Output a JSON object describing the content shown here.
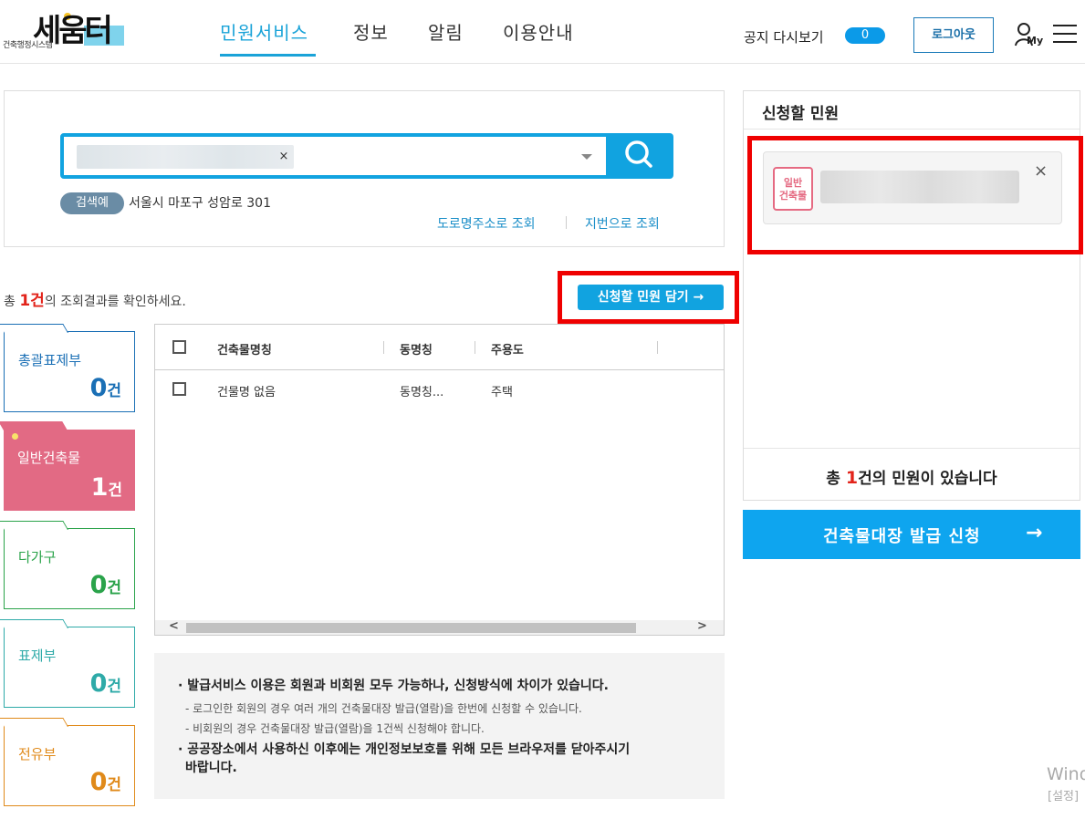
{
  "header": {
    "logo_text": "세움터",
    "logo_subtitle": "건축행정시스템",
    "nav": [
      "민원서비스",
      "정보",
      "알림",
      "이용안내"
    ],
    "notice_label": "공지 다시보기",
    "notice_count": "0",
    "logout_label": "로그아웃",
    "my_label": "My"
  },
  "search": {
    "chip_remove": "×",
    "example_tag": "검색예",
    "example_text": "서울시 마포구 성암로 301",
    "road_link": "도로명주소로 조회",
    "lot_link": "지번으로 조회"
  },
  "result": {
    "prefix": "총 ",
    "count": "1건",
    "suffix": "의 조회결과를 확인하세요.",
    "add_button": "신청할 민원 담기 →"
  },
  "categories": [
    {
      "label": "총괄표제부",
      "count": "0",
      "unit": "건",
      "color": "#1a6fb5"
    },
    {
      "label": "일반건축물",
      "count": "1",
      "unit": "건",
      "color": "#e26a84"
    },
    {
      "label": "다가구",
      "count": "0",
      "unit": "건",
      "color": "#2aa34a"
    },
    {
      "label": "표제부",
      "count": "0",
      "unit": "건",
      "color": "#2eaaa8"
    },
    {
      "label": "전유부",
      "count": "0",
      "unit": "건",
      "color": "#e08a1a"
    }
  ],
  "table": {
    "columns": [
      "건축물명칭",
      "동명칭",
      "주용도"
    ],
    "rows": [
      {
        "name": "건물명 없음",
        "dong": "동명칭...",
        "use": "주택"
      }
    ]
  },
  "notice": {
    "line1": "발급서비스 이용은 회원과 비회원 모두 가능하나, 신청방식에 차이가 있습니다.",
    "sub1": "- 로그인한 회원의 경우 여러 개의 건축물대장 발급(열람)을 한번에 신청할 수 있습니다.",
    "sub2": "- 비회원의 경우 건축물대장 발급(열람)을 1건씩 신청해야 합니다.",
    "line2a": "공공장소에서 사용하신 이후에는 개인정보보호를 위해 모든 브라우저를 닫아주시기",
    "line2b": "바랍니다."
  },
  "apply_panel": {
    "title": "신청할 민원",
    "item_badge_line1": "일반",
    "item_badge_line2": "건축물",
    "item_close": "×",
    "total_prefix": "총 ",
    "total_count": "1",
    "total_suffix": "건의 민원이 있습니다",
    "issue_button": "건축물대장 발급 신청",
    "issue_arrow": "→"
  },
  "watermark": {
    "line1": "Wind",
    "line2": "[설정]"
  }
}
